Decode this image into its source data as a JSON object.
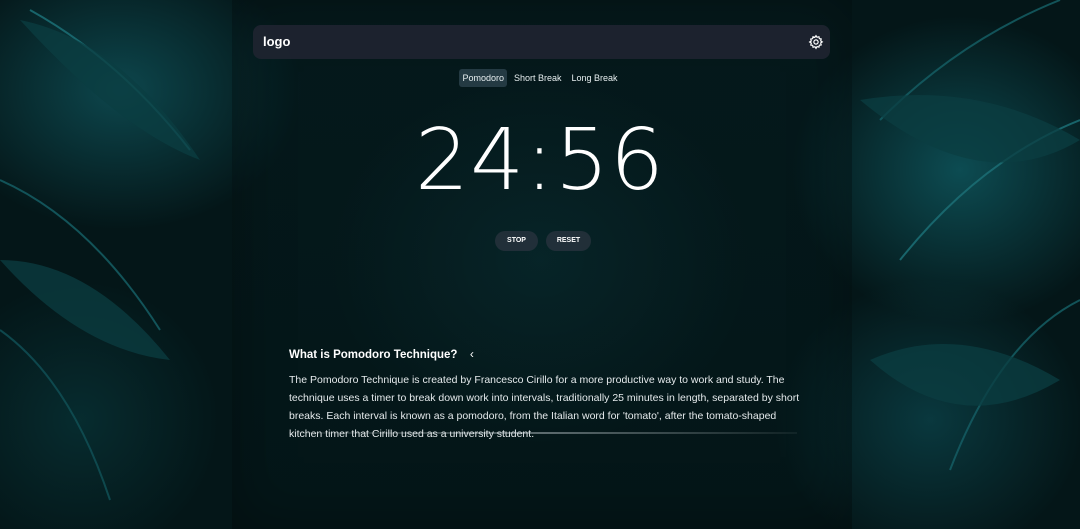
{
  "app": {
    "logo": "logo",
    "settings_icon": "gear-icon"
  },
  "tabs": [
    {
      "label": "Pomodoro",
      "active": true
    },
    {
      "label": "Short Break",
      "active": false
    },
    {
      "label": "Long Break",
      "active": false
    }
  ],
  "timer": {
    "display": "24:56"
  },
  "controls": {
    "stop_label": "STOP",
    "reset_label": "RESET"
  },
  "info": {
    "title": "What is Pomodoro Technique?",
    "toggle_icon": "chevron-left-icon",
    "body": "The Pomodoro Technique is created by Francesco Cirillo for a more productive way to work and study. The technique uses a timer to break down work into intervals, traditionally 25 minutes in length, separated by short breaks. Each interval is known as a pomodoro, from the Italian word for 'tomato', after the tomato-shaped kitchen timer that Cirillo used as a university student."
  },
  "colors": {
    "background": "#041618",
    "accent": "#1a7a82",
    "bar": "#1e2430"
  }
}
